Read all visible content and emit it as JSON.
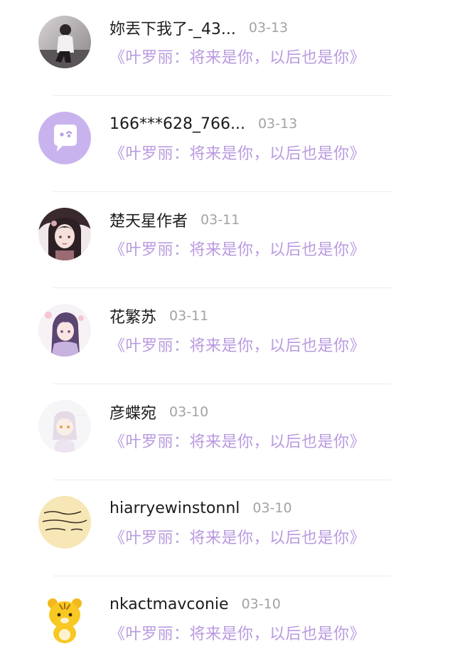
{
  "items": [
    {
      "username": "妳丟下我了-_43...",
      "date": "03-13",
      "book": "《叶罗丽：将来是你，以后也是你》",
      "avatar": "photo-person-avatar"
    },
    {
      "username": "166***628_766...",
      "date": "03-13",
      "book": "《叶罗丽：将来是你，以后也是你》",
      "avatar": "default-chat-avatar"
    },
    {
      "username": "楚天星作者",
      "date": "03-11",
      "book": "《叶罗丽：将来是你，以后也是你》",
      "avatar": "anime-girl-avatar"
    },
    {
      "username": "花繁苏",
      "date": "03-11",
      "book": "《叶罗丽：将来是你，以后也是你》",
      "avatar": "anime-girl-purple-avatar"
    },
    {
      "username": "彦蝶宛",
      "date": "03-10",
      "book": "《叶罗丽：将来是你，以后也是你》",
      "avatar": "anime-chibi-avatar"
    },
    {
      "username": "hiarryewinstonnl",
      "date": "03-10",
      "book": "《叶罗丽：将来是你，以后也是你》",
      "avatar": "handwriting-avatar"
    },
    {
      "username": "nkactmavconie",
      "date": "03-10",
      "book": "《叶罗丽：将来是你，以后也是你》",
      "avatar": "tiger-avatar"
    }
  ],
  "colors": {
    "username": "#1c1c1c",
    "date": "#a3a3a3",
    "book_title": "#b99ae0",
    "default_avatar_bg": "#c9b3ef"
  }
}
